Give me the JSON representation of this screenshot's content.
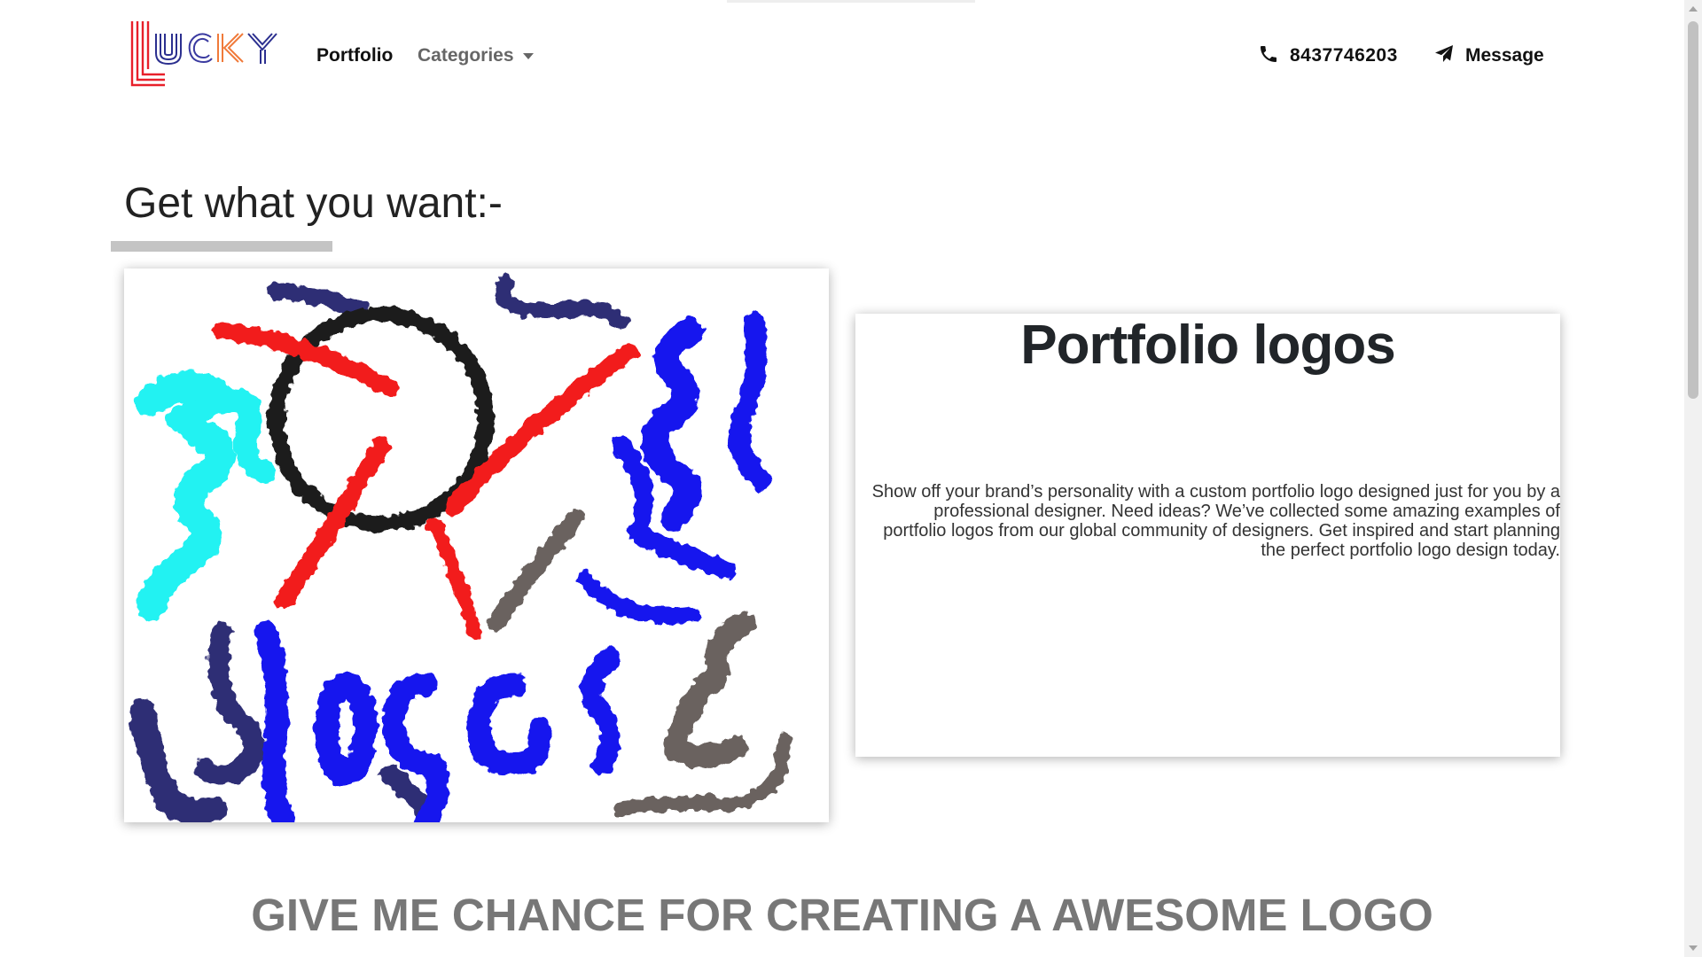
{
  "nav": {
    "brand": "LUCKY",
    "portfolio_label": "Portfolio",
    "categories_label": "Categories",
    "phone": "8437746203",
    "message_label": "Message"
  },
  "hero": {
    "title": "Get what you want:-"
  },
  "portfolio_card": {
    "heading": "Portfolio logos",
    "body": "Show off your brand’s personality with a custom portfolio logo designed just for you by a professional designer. Need ideas? We’ve collected some amazing examples of portfolio logos from our global community of designers. Get inspired and start planning the perfect portfolio logo design today."
  },
  "cta": {
    "text": "GIVE ME CHANCE FOR CREATING A AWESOME LOGO"
  },
  "icons": {
    "phone": "phone-icon",
    "message": "paper-plane-icon",
    "categories_caret": "caret-down-icon"
  },
  "colors": {
    "brand_red": "#e8202a",
    "brand_blue": "#2b2f8f",
    "brand_orange": "#f07a3a",
    "cta_gray": "#777777",
    "stroke_cyan": "#22f2f2",
    "stroke_blue": "#1515ee",
    "stroke_navy": "#2f2d75",
    "stroke_red": "#f21b1b",
    "stroke_black": "#1a1a1a",
    "stroke_gray": "#6a625e"
  }
}
